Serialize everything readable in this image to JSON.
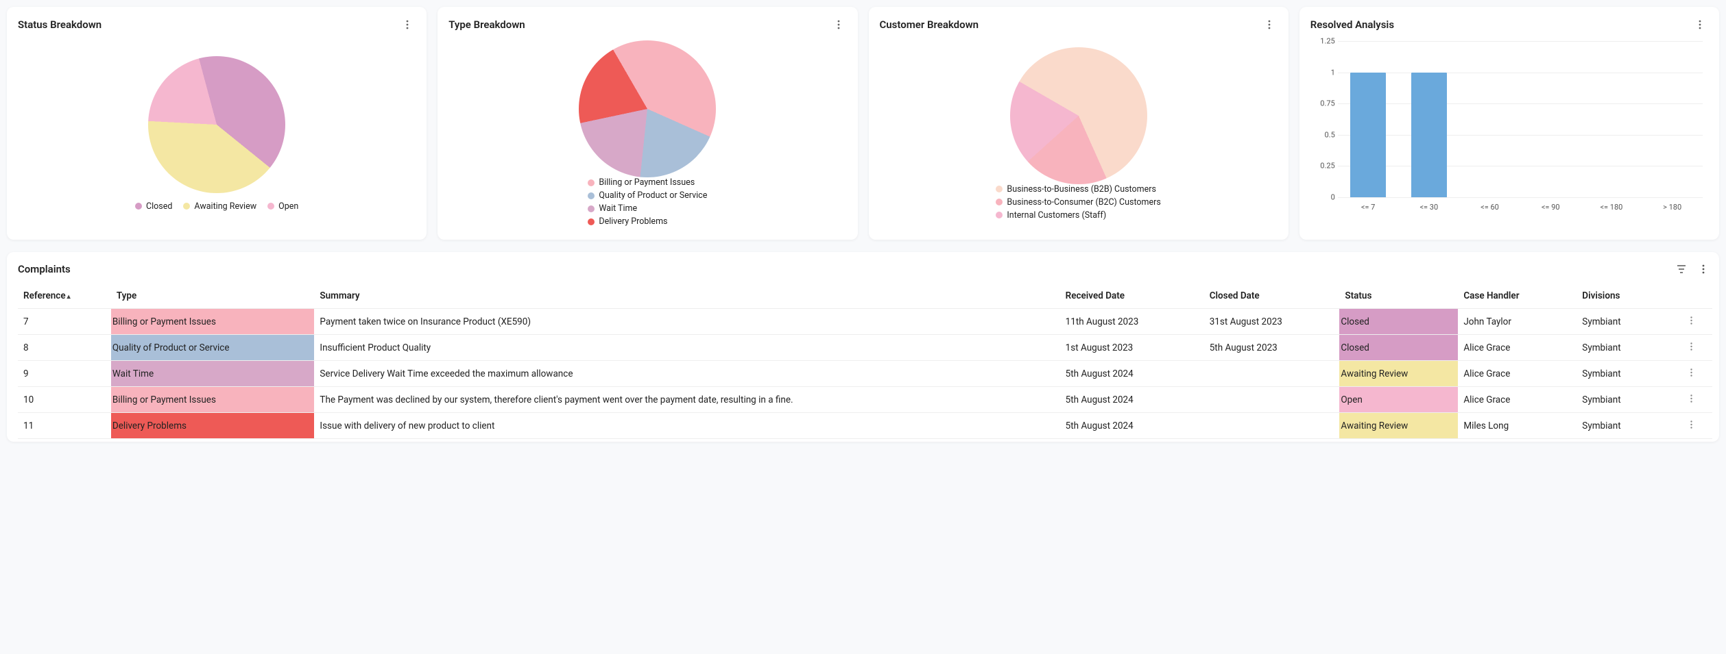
{
  "charts": {
    "status": {
      "title": "Status Breakdown"
    },
    "type": {
      "title": "Type Breakdown"
    },
    "customer": {
      "title": "Customer Breakdown"
    },
    "resolved": {
      "title": "Resolved Analysis"
    }
  },
  "legends": {
    "status": [
      "Closed",
      "Awaiting Review",
      "Open"
    ],
    "type": [
      "Billing or Payment Issues",
      "Quality of Product or Service",
      "Wait Time",
      "Delivery Problems"
    ],
    "customer": [
      "Business-to-Business (B2B) Customers",
      "Business-to-Consumer (B2C) Customers",
      "Internal Customers (Staff)"
    ]
  },
  "colors": {
    "status": [
      "#d69cc5",
      "#f4e7a3",
      "#f5b7cf"
    ],
    "type": [
      "#f8b3bd",
      "#a9bfd8",
      "#d7a8c8",
      "#ee5a56"
    ],
    "customer": [
      "#fadacb",
      "#f8b3bd",
      "#f5b7cf"
    ],
    "statusCell": {
      "Closed": "#d69cc5",
      "Awaiting Review": "#f4e7a3",
      "Open": "#f5b7cf"
    },
    "typeCell": {
      "Billing or Payment Issues": "#f8b3bd",
      "Quality of Product or Service": "#a9bfd8",
      "Wait Time": "#d7a8c8",
      "Delivery Problems": "#ee5a56"
    }
  },
  "chart_data": [
    {
      "id": "status",
      "type": "pie",
      "title": "Status Breakdown",
      "series": [
        {
          "name": "Closed",
          "value": 40
        },
        {
          "name": "Awaiting Review",
          "value": 40
        },
        {
          "name": "Open",
          "value": 20
        }
      ]
    },
    {
      "id": "type",
      "type": "pie",
      "title": "Type Breakdown",
      "series": [
        {
          "name": "Billing or Payment Issues",
          "value": 40
        },
        {
          "name": "Quality of Product or Service",
          "value": 20
        },
        {
          "name": "Wait Time",
          "value": 20
        },
        {
          "name": "Delivery Problems",
          "value": 20
        }
      ]
    },
    {
      "id": "customer",
      "type": "pie",
      "title": "Customer Breakdown",
      "series": [
        {
          "name": "Business-to-Business (B2B) Customers",
          "value": 60
        },
        {
          "name": "Business-to-Consumer (B2C) Customers",
          "value": 20
        },
        {
          "name": "Internal Customers (Staff)",
          "value": 20
        }
      ]
    },
    {
      "id": "resolved",
      "type": "bar",
      "title": "Resolved Analysis",
      "categories": [
        "<= 7",
        "<= 30",
        "<= 60",
        "<= 90",
        "<= 180",
        "> 180"
      ],
      "values": [
        1,
        1,
        0,
        0,
        0,
        0
      ],
      "ylabel": "",
      "xlabel": "",
      "ylim": [
        0,
        1.25
      ],
      "yticks": [
        0,
        0.25,
        0.5,
        0.75,
        1,
        1.25
      ]
    }
  ],
  "table": {
    "title": "Complaints",
    "sort_column": "Reference",
    "columns": [
      "Reference",
      "Type",
      "Summary",
      "Received Date",
      "Closed Date",
      "Status",
      "Case Handler",
      "Divisions"
    ],
    "rows": [
      {
        "ref": "7",
        "type": "Billing or Payment Issues",
        "summary": "Payment taken twice on Insurance Product (XE590)",
        "received": "11th August 2023",
        "closed": "31st August 2023",
        "status": "Closed",
        "handler": "John Taylor",
        "division": "Symbiant"
      },
      {
        "ref": "8",
        "type": "Quality of Product or Service",
        "summary": "Insufficient Product Quality",
        "received": "1st August 2023",
        "closed": "5th August 2023",
        "status": "Closed",
        "handler": "Alice Grace",
        "division": "Symbiant"
      },
      {
        "ref": "9",
        "type": "Wait Time",
        "summary": "Service Delivery Wait Time exceeded the maximum allowance",
        "received": "5th August 2024",
        "closed": "",
        "status": "Awaiting Review",
        "handler": "Alice Grace",
        "division": "Symbiant"
      },
      {
        "ref": "10",
        "type": "Billing or Payment Issues",
        "summary": "The Payment was declined by our system, therefore client's payment went over the payment date, resulting in a fine.",
        "received": "5th August 2024",
        "closed": "",
        "status": "Open",
        "handler": "Alice Grace",
        "division": "Symbiant"
      },
      {
        "ref": "11",
        "type": "Delivery Problems",
        "summary": "Issue with delivery of new product to client",
        "received": "5th August 2024",
        "closed": "",
        "status": "Awaiting Review",
        "handler": "Miles Long",
        "division": "Symbiant"
      }
    ]
  }
}
